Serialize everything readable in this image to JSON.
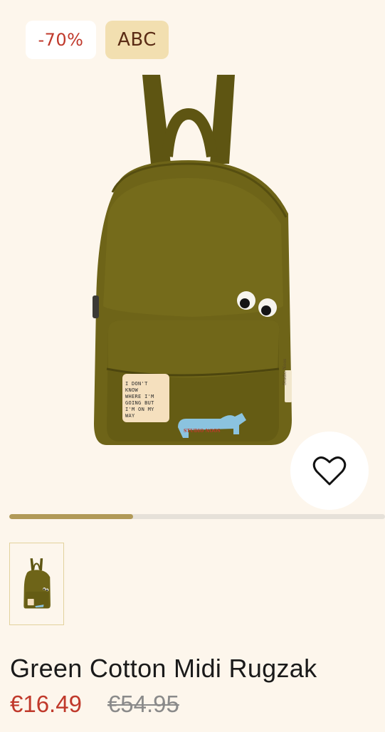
{
  "badges": {
    "discount": "-70%",
    "brand": "ABC"
  },
  "gallery": {
    "main_image_icon": "backpack-image",
    "wishlist_icon": "heart-outline-icon",
    "progress_fraction": 0.33,
    "thumbnail_icon": "backpack-thumbnail"
  },
  "patch": {
    "text_lines": [
      "I DON'T",
      "KNOW",
      "WHERE I'M",
      "GOING BUT",
      "I'M ON MY",
      "WAY"
    ],
    "dog_label": "STUDIO NOOS",
    "side_label": "Studio Noos"
  },
  "product": {
    "title": "Green Cotton Midi Rugzak",
    "price_sale": "€16.49",
    "price_original": "€54.95"
  },
  "colors": {
    "background": "#fdf6ec",
    "accent_sale": "#c0392b",
    "backpack": "#6e6418",
    "progress": "#b19a58"
  }
}
